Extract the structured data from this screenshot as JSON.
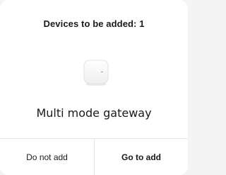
{
  "dialog": {
    "title": "Devices to be added: 1",
    "device": {
      "name": "Multi mode gateway",
      "icon": "gateway-device-icon"
    },
    "buttons": {
      "cancel_label": "Do not add",
      "confirm_label": "Go to add"
    }
  },
  "colors": {
    "text": "#1a1a1a",
    "background": "#ffffff",
    "divider": "#e6e6e6",
    "device_body": "#f7f7f7"
  }
}
